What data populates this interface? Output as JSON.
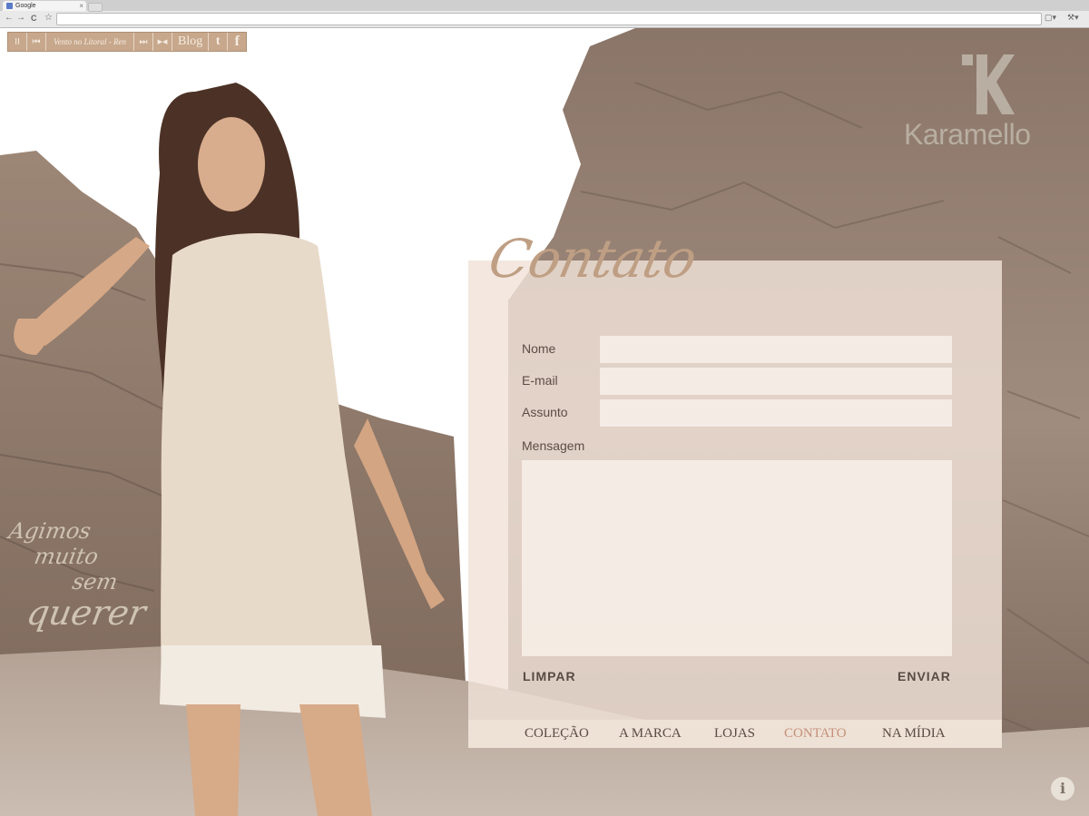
{
  "browser": {
    "tab_title": "Google",
    "tab_close": "×",
    "nav": {
      "back": "←",
      "forward": "→",
      "reload": "C",
      "star": "☆"
    },
    "right": {
      "page": "▢▾",
      "wrench": "⚒▾"
    }
  },
  "player": {
    "pause": "II",
    "prev": "⏮",
    "track": "Vento no Litoral - Ren",
    "next": "⏭",
    "volume": "▶◀",
    "blog": "Blog",
    "twitter": "t",
    "facebook": "f"
  },
  "brand": {
    "name": "Karamello"
  },
  "slogan": [
    "Agimos",
    "muito",
    "sem",
    "querer"
  ],
  "contact": {
    "title": "Contato",
    "fields": {
      "nome": "Nome",
      "email": "E-mail",
      "assunto": "Assunto",
      "mensagem": "Mensagem"
    },
    "clear_label": "LIMPAR",
    "send_label": "ENVIAR"
  },
  "nav": {
    "items": [
      "COLEÇÃO",
      "A MARCA",
      "LOJAS",
      "CONTATO",
      "NA MÍDIA"
    ],
    "active": "CONTATO"
  },
  "info_label": "i",
  "colors": {
    "accent": "#c4907a",
    "panel": "#f0e2d8",
    "brand": "#b8aea1"
  }
}
